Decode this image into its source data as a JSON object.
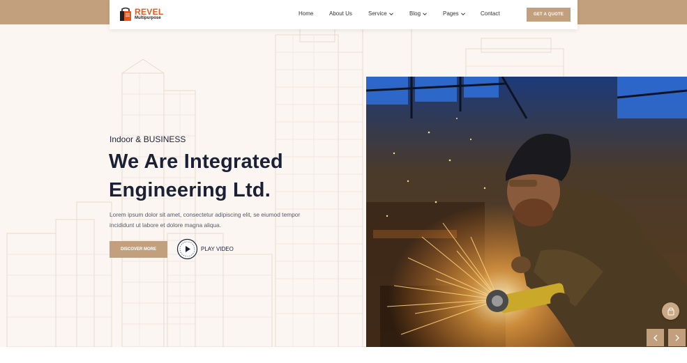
{
  "brand": {
    "name": "REVEL",
    "tagline": "Multipurpose",
    "accent_color": "#c2a07e",
    "logo_color": "#e8551f",
    "heading_color": "#1b2134"
  },
  "nav": {
    "items": [
      {
        "label": "Home",
        "has_dropdown": false
      },
      {
        "label": "About Us",
        "has_dropdown": false
      },
      {
        "label": "Service",
        "has_dropdown": true
      },
      {
        "label": "Blog",
        "has_dropdown": true
      },
      {
        "label": "Pages",
        "has_dropdown": true
      },
      {
        "label": "Contact",
        "has_dropdown": false
      }
    ],
    "cta_label": "GET A QUOTE"
  },
  "hero": {
    "eyebrow": "Indoor & BUSINESS",
    "headline_line1": "We Are Integrated",
    "headline_line2": "Engineering Ltd.",
    "description": "Lorem ipsum dolor sit amet, consectetur adipiscing elit, se eiumod tempor incididunt ut labore et dolore magna aliqua.",
    "primary_button": "DISCOVER MORE",
    "video_button": "PLAY VIDEO",
    "image_subject": "welder-grinding-sparks"
  },
  "icons": {
    "play": "play-icon",
    "chevron": "chevron-down-icon",
    "prev": "chevron-left-icon",
    "next": "chevron-right-icon",
    "floating": "cart-icon"
  }
}
